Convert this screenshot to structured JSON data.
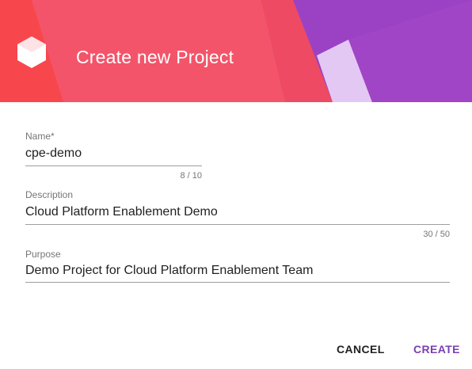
{
  "dialog": {
    "title": "Create new Project",
    "colors": {
      "header_red": "#f45469",
      "header_left": "#f8464d",
      "header_purple": "#9b42c4",
      "header_lavender": "#e3c8f3",
      "accent": "#7b3fb1"
    },
    "icon": "cube-icon"
  },
  "form": {
    "name": {
      "label": "Name*",
      "value": "cpe-demo",
      "counter": "8 / 10"
    },
    "description": {
      "label": "Description",
      "value": "Cloud Platform Enablement Demo",
      "counter": "30 / 50"
    },
    "purpose": {
      "label": "Purpose",
      "value": "Demo Project for Cloud Platform Enablement Team"
    }
  },
  "actions": {
    "cancel_label": "CANCEL",
    "create_label": "CREATE"
  }
}
